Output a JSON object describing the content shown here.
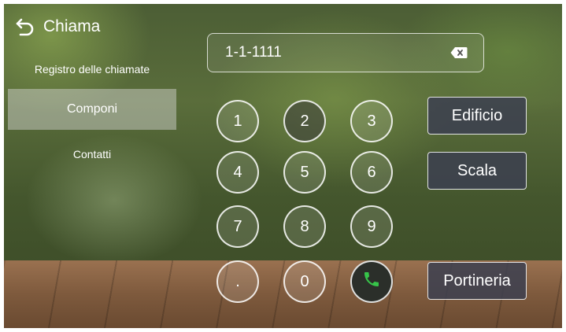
{
  "header": {
    "title": "Chiama"
  },
  "sidebar": {
    "items": [
      {
        "label": "Registro delle chiamate"
      },
      {
        "label": "Componi"
      },
      {
        "label": "Contatti"
      }
    ]
  },
  "dialer": {
    "display_value": "1-1-1111",
    "keys": [
      "1",
      "2",
      "3",
      "4",
      "5",
      "6",
      "7",
      "8",
      "9",
      ".",
      "0"
    ]
  },
  "actions": {
    "edificio": "Edificio",
    "scala": "Scala",
    "portineria": "Portineria"
  },
  "icons": {
    "back": "back-arrow-icon",
    "backspace": "backspace-icon",
    "call": "phone-icon"
  },
  "colors": {
    "call_icon": "#37c44a"
  }
}
